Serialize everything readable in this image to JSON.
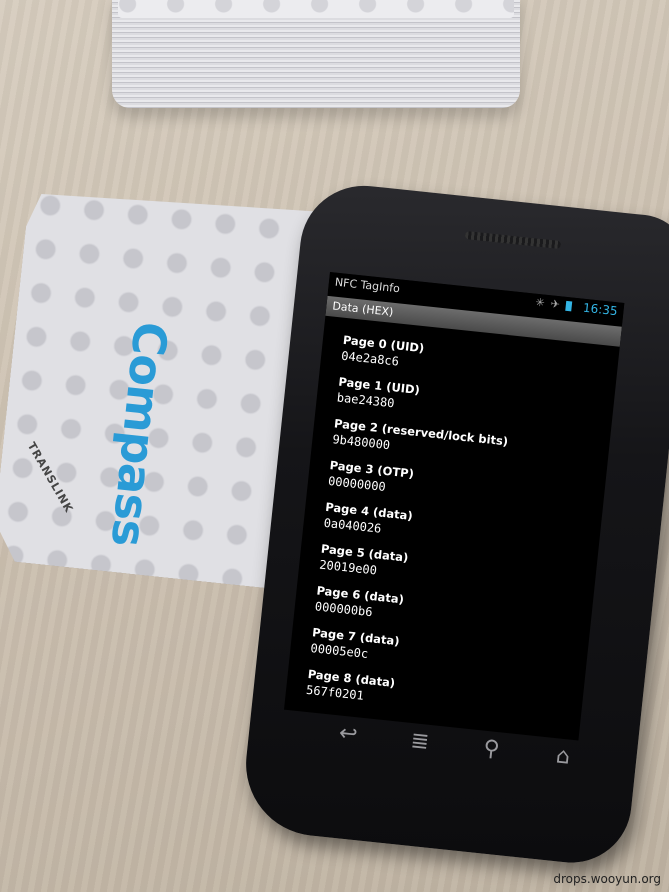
{
  "status": {
    "time": "16:35"
  },
  "app": {
    "title": "NFC TagInfo",
    "section": "Data (HEX)"
  },
  "pages": [
    {
      "label": "Page 0 (UID)",
      "value": "04e2a8c6"
    },
    {
      "label": "Page 1 (UID)",
      "value": "bae24380"
    },
    {
      "label": "Page 2 (reserved/lock bits)",
      "value": "9b480000"
    },
    {
      "label": "Page 3 (OTP)",
      "value": "00000000"
    },
    {
      "label": "Page 4 (data)",
      "value": "0a040026"
    },
    {
      "label": "Page 5 (data)",
      "value": "20019e00"
    },
    {
      "label": "Page 6 (data)",
      "value": "000000b6"
    },
    {
      "label": "Page 7 (data)",
      "value": "00005e0c"
    },
    {
      "label": "Page 8 (data)",
      "value": "567f0201"
    }
  ],
  "card": {
    "brand": "Compass",
    "issuer": "TRANSLINK"
  },
  "navbar": {
    "back_icon": "back-icon",
    "menu_icon": "menu-icon",
    "search_icon": "search-icon",
    "home_icon": "home-icon"
  },
  "watermark": "drops.wooyun.org",
  "colors": {
    "accent": "#33b5e5",
    "brand": "#2a9bd6"
  }
}
